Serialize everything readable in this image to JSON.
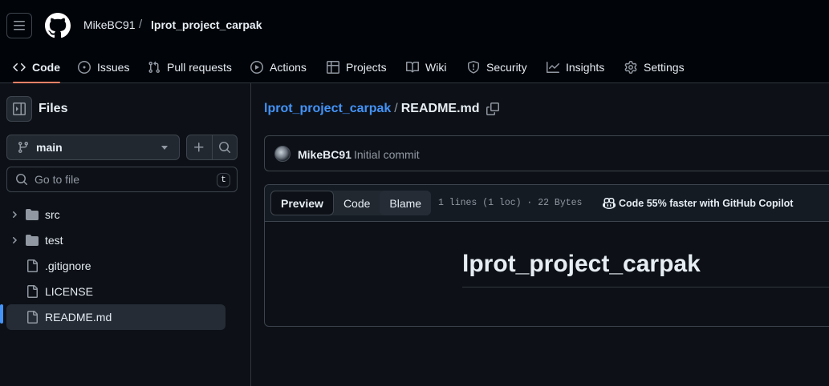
{
  "header": {
    "owner": "MikeBC91",
    "separator": "/",
    "repo": "lprot_project_carpak"
  },
  "tabs": [
    {
      "label": "Code",
      "icon": "code-icon",
      "active": true
    },
    {
      "label": "Issues",
      "icon": "issue-icon"
    },
    {
      "label": "Pull requests",
      "icon": "pull-request-icon"
    },
    {
      "label": "Actions",
      "icon": "play-icon"
    },
    {
      "label": "Projects",
      "icon": "table-icon"
    },
    {
      "label": "Wiki",
      "icon": "book-icon"
    },
    {
      "label": "Security",
      "icon": "shield-icon"
    },
    {
      "label": "Insights",
      "icon": "graph-icon"
    },
    {
      "label": "Settings",
      "icon": "gear-icon"
    }
  ],
  "sidebar": {
    "title": "Files",
    "branch": "main",
    "goto_placeholder": "Go to file",
    "goto_shortcut": "t",
    "tree": [
      {
        "name": "src",
        "type": "folder"
      },
      {
        "name": "test",
        "type": "folder"
      },
      {
        "name": ".gitignore",
        "type": "file"
      },
      {
        "name": "LICENSE",
        "type": "file"
      },
      {
        "name": "README.md",
        "type": "file",
        "selected": true
      }
    ]
  },
  "main": {
    "path_repo": "lprot_project_carpak",
    "path_sep": "/",
    "path_file": "README.md",
    "commit": {
      "user": "MikeBC91",
      "message": "Initial commit"
    },
    "file": {
      "tabs": [
        "Preview",
        "Code",
        "Blame"
      ],
      "active_tab": "Preview",
      "meta": "1 lines (1 loc) · 22 Bytes",
      "copilot": "Code 55% faster with GitHub Copilot",
      "heading": "lprot_project_carpak"
    }
  },
  "colors": {
    "accent_link": "#4493f8",
    "tab_underline": "#f78166",
    "background": "#0d1117"
  }
}
